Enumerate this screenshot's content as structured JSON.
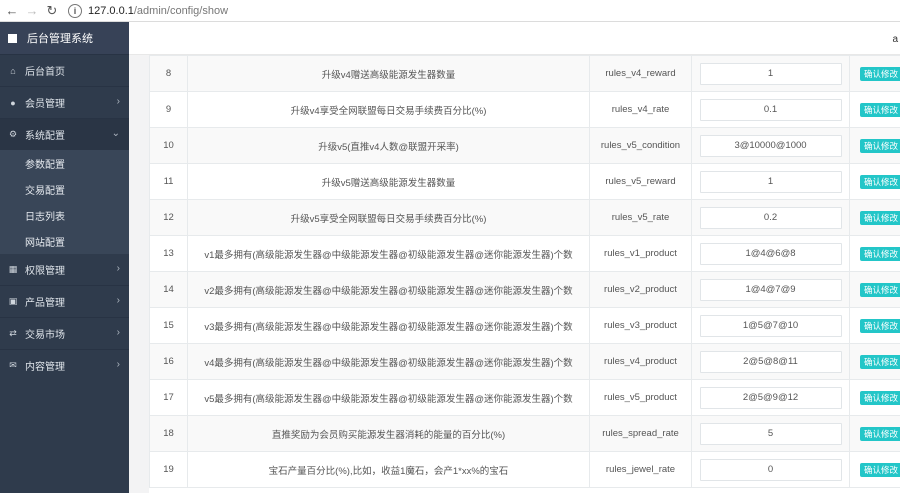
{
  "browser": {
    "back_icon": "arrow-left-icon",
    "forward_icon": "arrow-right-icon",
    "reload_icon": "reload-icon",
    "url_host": "127.0.0.1",
    "url_path": "/admin/config/show"
  },
  "sidebar": {
    "brand": "后台管理系统",
    "items": [
      {
        "label": "后台首页",
        "icon": "home-icon"
      },
      {
        "label": "会员管理",
        "icon": "user-icon"
      },
      {
        "label": "系统配置",
        "icon": "gears-icon"
      },
      {
        "label": "权限管理",
        "icon": "keyboard-icon"
      },
      {
        "label": "产品管理",
        "icon": "windows-icon"
      },
      {
        "label": "交易市场",
        "icon": "exchange-icon"
      },
      {
        "label": "内容管理",
        "icon": "envelope-icon"
      }
    ],
    "submenu": [
      {
        "label": "参数配置"
      },
      {
        "label": "交易配置"
      },
      {
        "label": "日志列表"
      },
      {
        "label": "网站配置"
      }
    ]
  },
  "header": {
    "user_initial": "a"
  },
  "table": {
    "action_label": "确认修改",
    "rows": [
      {
        "id": "8",
        "desc": "升级v4赠送高级能源发生器数量",
        "key": "rules_v4_reward",
        "value": "1"
      },
      {
        "id": "9",
        "desc": "升级v4享受全网联盟每日交易手续费百分比(%)",
        "key": "rules_v4_rate",
        "value": "0.1"
      },
      {
        "id": "10",
        "desc": "升级v5(直推v4人数@联盟开采率)",
        "key": "rules_v5_condition",
        "value": "3@10000@1000"
      },
      {
        "id": "11",
        "desc": "升级v5赠送高级能源发生器数量",
        "key": "rules_v5_reward",
        "value": "1"
      },
      {
        "id": "12",
        "desc": "升级v5享受全网联盟每日交易手续费百分比(%)",
        "key": "rules_v5_rate",
        "value": "0.2"
      },
      {
        "id": "13",
        "desc": "v1最多拥有(高级能源发生器@中级能源发生器@初级能源发生器@迷你能源发生器)个数",
        "key": "rules_v1_product",
        "value": "1@4@6@8"
      },
      {
        "id": "14",
        "desc": "v2最多拥有(高级能源发生器@中级能源发生器@初级能源发生器@迷你能源发生器)个数",
        "key": "rules_v2_product",
        "value": "1@4@7@9"
      },
      {
        "id": "15",
        "desc": "v3最多拥有(高级能源发生器@中级能源发生器@初级能源发生器@迷你能源发生器)个数",
        "key": "rules_v3_product",
        "value": "1@5@7@10"
      },
      {
        "id": "16",
        "desc": "v4最多拥有(高级能源发生器@中级能源发生器@初级能源发生器@迷你能源发生器)个数",
        "key": "rules_v4_product",
        "value": "2@5@8@11"
      },
      {
        "id": "17",
        "desc": "v5最多拥有(高级能源发生器@中级能源发生器@初级能源发生器@迷你能源发生器)个数",
        "key": "rules_v5_product",
        "value": "2@5@9@12"
      },
      {
        "id": "18",
        "desc": "直推奖励为会员购买能源发生器消耗的能量的百分比(%)",
        "key": "rules_spread_rate",
        "value": "5"
      },
      {
        "id": "19",
        "desc": "宝石产量百分比(%),比如，收益1魔石，会产1*xx%的宝石",
        "key": "rules_jewel_rate",
        "value": "0"
      }
    ]
  },
  "colors": {
    "sidebar_bg": "#2f3b4c",
    "brand_bg": "#374257",
    "submenu_bg": "#394658",
    "action_btn": "#23c6c8"
  }
}
